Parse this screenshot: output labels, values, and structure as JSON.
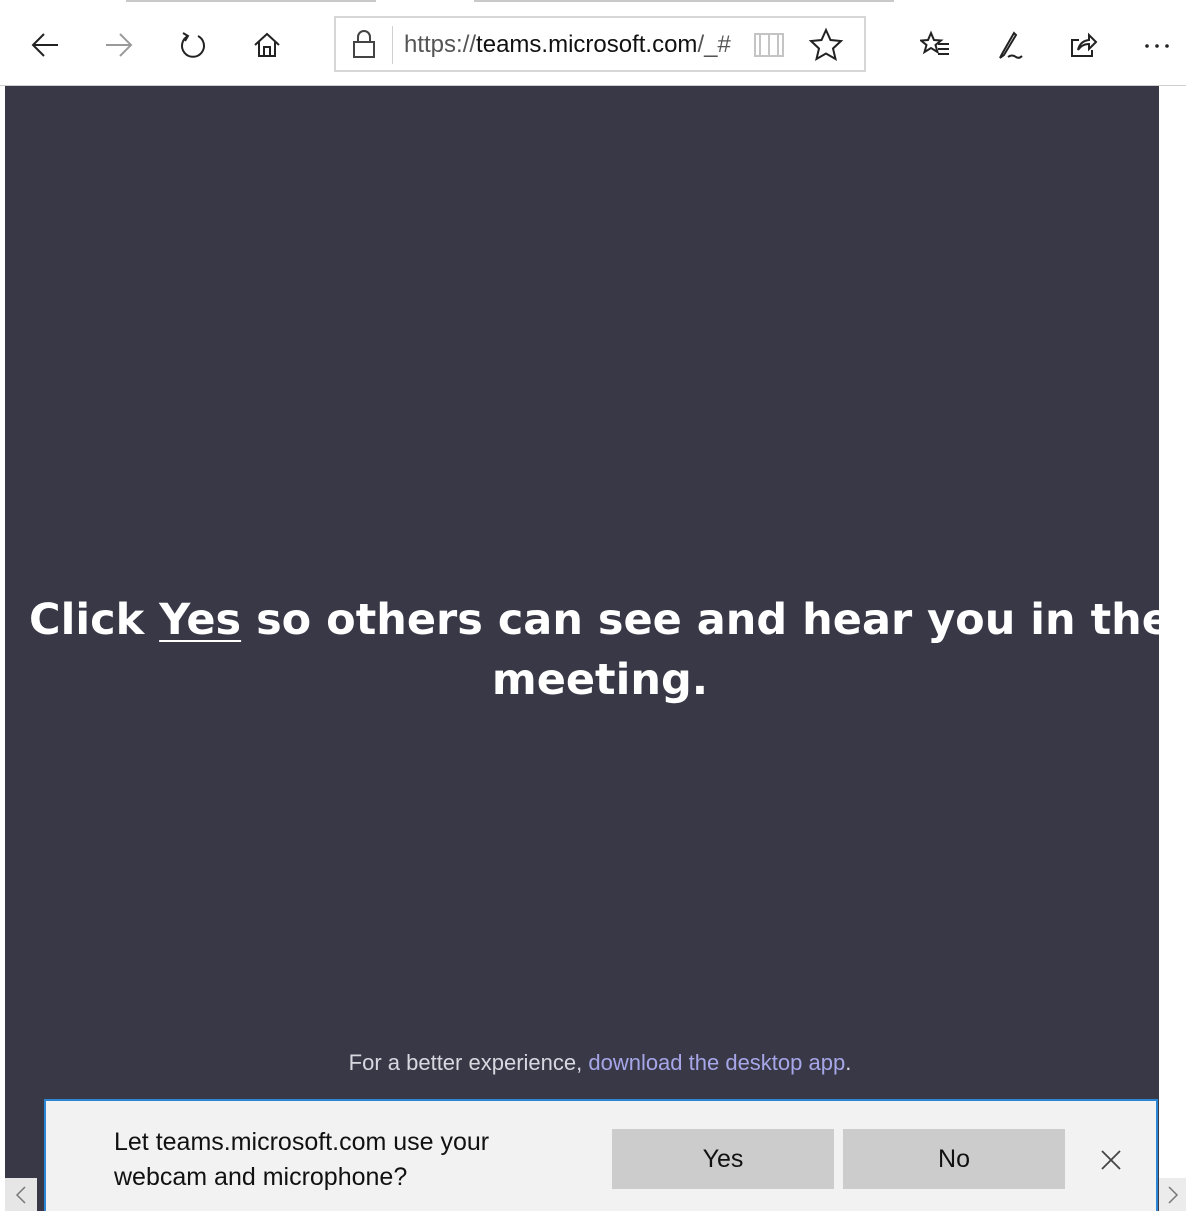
{
  "browser": {
    "address": {
      "scheme": "https://",
      "host": "teams.microsoft.com",
      "path": "/_#"
    }
  },
  "page": {
    "message_before": "Click ",
    "message_yes": "Yes",
    "message_after": " so others can see and hear you in the meeting.",
    "hint_prefix": "For a better experience, ",
    "hint_link": "download the desktop app",
    "hint_suffix": "."
  },
  "permission": {
    "prompt": "Let teams.microsoft.com use your webcam and microphone?",
    "yes_label": "Yes",
    "no_label": "No"
  },
  "colors": {
    "page_background": "#393847",
    "link": "#a6a6e8",
    "permission_border": "#2b86d6",
    "button_background": "#cccccc"
  }
}
